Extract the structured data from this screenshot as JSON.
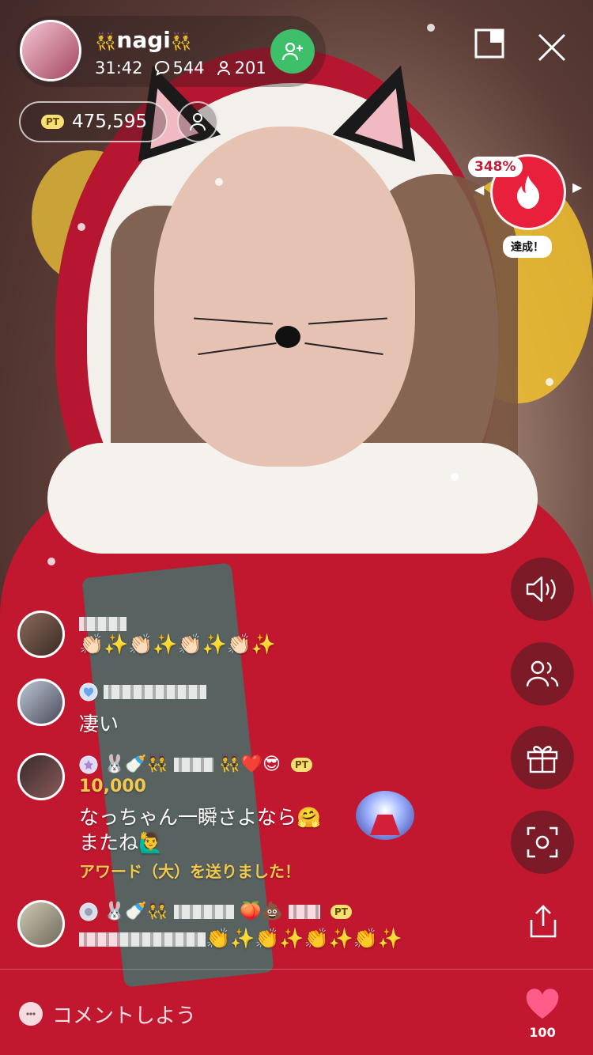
{
  "host": {
    "name": "nagi",
    "name_prefix": "👯",
    "name_suffix": "👯",
    "duration": "31:42",
    "comments": "544",
    "viewers": "201"
  },
  "points": {
    "badge": "PT",
    "value": "475,595"
  },
  "event": {
    "percent": "348%",
    "status": "達成！"
  },
  "comments": [
    {
      "name": "",
      "text": "👏🏻✨👏🏻✨👏🏻✨👏🏻✨"
    },
    {
      "name": "",
      "text": "凄い"
    },
    {
      "emojis": "🐰🍼👯",
      "suffix": "👯❤️😎",
      "pt": "PT",
      "amount": "10,000",
      "line1": "なっちゃん一瞬さよなら🤗",
      "line2": "またね🙋‍♂️",
      "award": "アワード（大）を送りました！"
    },
    {
      "emojis": "🐰🍼👯",
      "suffix": "🍑💩",
      "pt": "PT",
      "text": "👏✨👏✨👏✨👏✨"
    }
  ],
  "bottom": {
    "placeholder": "コメントしよう",
    "likes": "100"
  },
  "colors": {
    "accent_green": "#3ec06a",
    "event_red": "#e8203b",
    "gold": "#f2c94c",
    "heart_pink": "#ff5c8a"
  }
}
